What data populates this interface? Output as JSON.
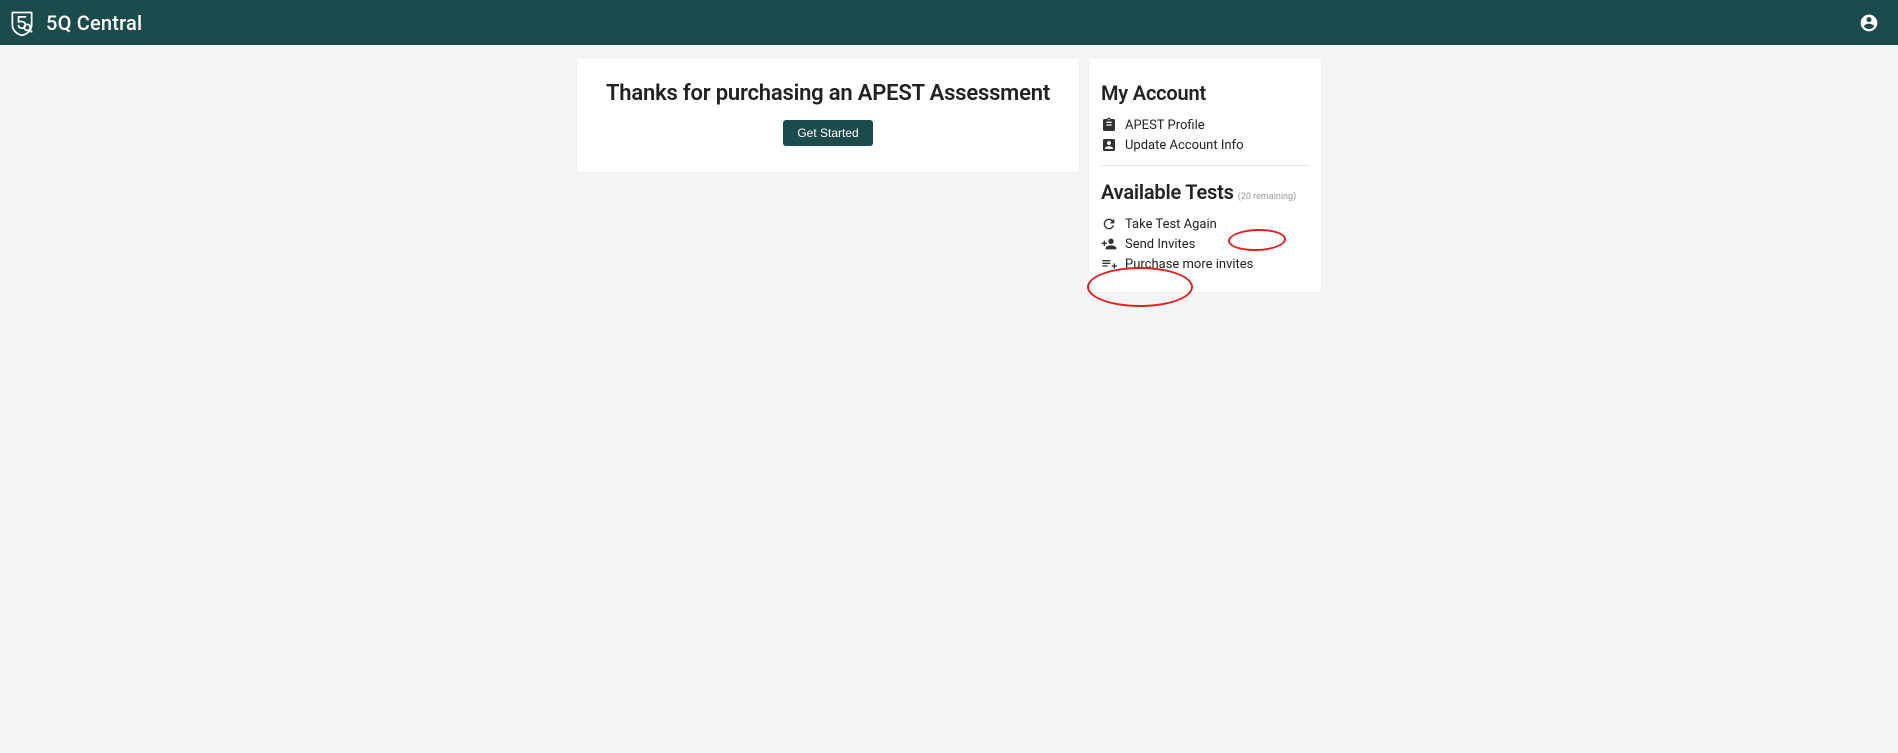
{
  "brand": {
    "title": "5Q Central"
  },
  "main": {
    "heading": "Thanks for purchasing an APEST Assessment",
    "cta_label": "Get Started"
  },
  "sidebar": {
    "account_heading": "My Account",
    "account_items": [
      {
        "label": "APEST Profile",
        "icon": "clipboard-icon"
      },
      {
        "label": "Update Account Info",
        "icon": "person-box-icon"
      }
    ],
    "tests_heading": "Available Tests",
    "tests_remaining": "(20 remaining)",
    "tests_items": [
      {
        "label": "Take Test Again",
        "icon": "refresh-icon"
      },
      {
        "label": "Send Invites",
        "icon": "person-add-icon"
      },
      {
        "label": "Purchase more invites",
        "icon": "playlist-add-icon"
      }
    ]
  },
  "colors": {
    "brand": "#1c4b4b",
    "annotation": "#d22"
  }
}
